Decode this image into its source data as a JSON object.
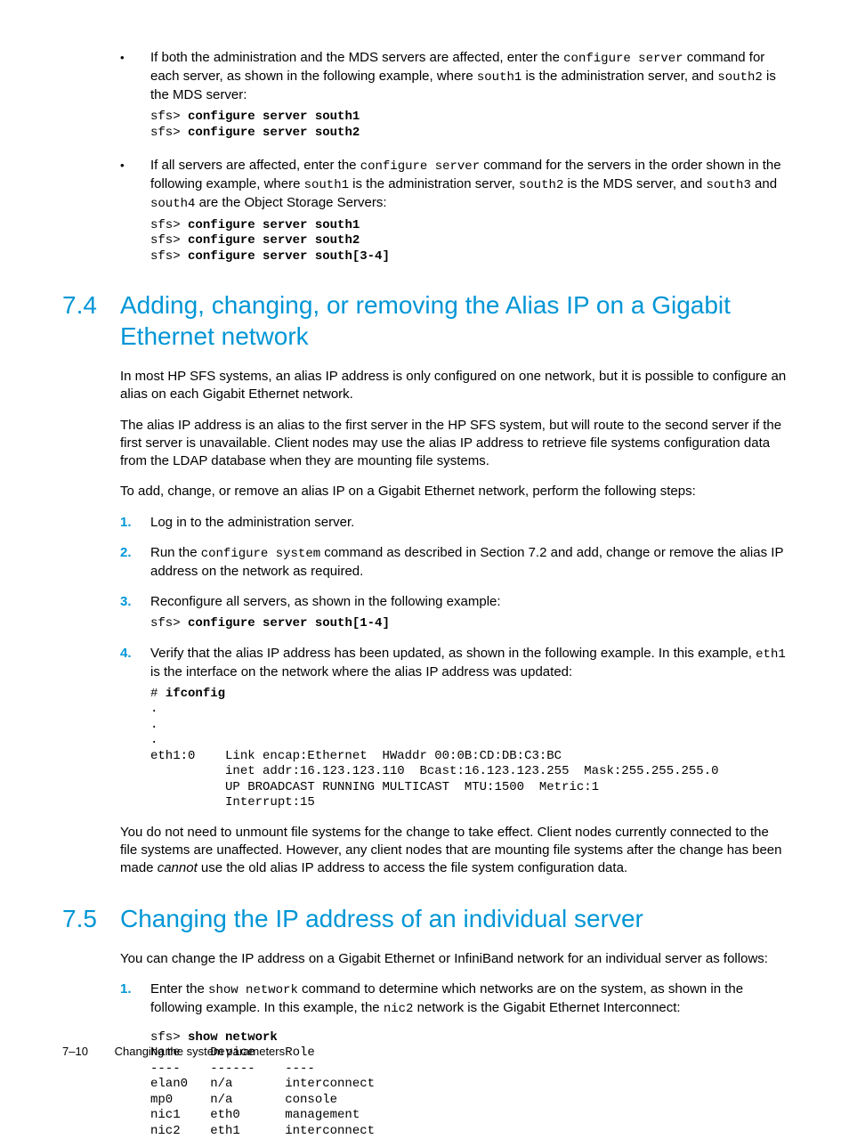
{
  "bullet1": {
    "text_a": "If both the administration and the MDS servers are affected, enter the ",
    "code_a": "configure server",
    "text_b": " command for each server, as shown in the following example, where ",
    "code_b": "south1",
    "text_c": " is the administration server, and ",
    "code_c": "south2",
    "text_d": " is the MDS server:",
    "code_prompt1": "sfs> ",
    "code_cmd1": "configure server south1",
    "code_prompt2": "sfs> ",
    "code_cmd2": "configure server south2"
  },
  "bullet2": {
    "text_a": "If all servers are affected, enter the ",
    "code_a": "configure server",
    "text_b": " command for the servers in the order shown in the following example, where ",
    "code_b": "south1",
    "text_c": " is the administration server, ",
    "code_c": "south2",
    "text_d": " is the MDS server, and ",
    "code_d": "south3",
    "text_e": " and ",
    "code_e": "south4",
    "text_f": " are the Object Storage Servers:",
    "code_prompt1": "sfs> ",
    "code_cmd1": "configure server south1",
    "code_prompt2": "sfs> ",
    "code_cmd2": "configure server south2",
    "code_prompt3": "sfs> ",
    "code_cmd3": "configure server south[3-4]"
  },
  "sec74": {
    "num": "7.4",
    "title": "Adding, changing, or removing the Alias IP on a Gigabit Ethernet network",
    "p1": "In most HP SFS systems, an alias IP address is only configured on one network, but it is possible to configure an alias on each Gigabit Ethernet network.",
    "p2": "The alias IP address is an alias to the first server in the HP SFS system, but will route to the second server if the first server is unavailable. Client nodes may use the alias IP address to retrieve file systems configuration data from the LDAP database when they are mounting file systems.",
    "p3": "To add, change, or remove an alias IP on a Gigabit Ethernet network, perform the following steps:",
    "step1": "Log in to the administration server.",
    "step2a": "Run the ",
    "step2code": "configure system",
    "step2b": " command as described in Section 7.2 and add, change or remove the alias IP address on the network as required.",
    "step3": "Reconfigure all servers, as shown in the following example:",
    "step3_prompt": "sfs> ",
    "step3_cmd": "configure server south[1-4]",
    "step4a": "Verify that the alias IP address has been updated, as shown in the following example. In this example, ",
    "step4code": "eth1",
    "step4b": " is the interface on the network where the alias IP address was updated:",
    "step4_hash": "# ",
    "step4_cmd": "ifconfig",
    "step4_out": ".\n.\n.\neth1:0    Link encap:Ethernet  HWaddr 00:0B:CD:DB:C3:BC\n          inet addr:16.123.123.110  Bcast:16.123.123.255  Mask:255.255.255.0\n          UP BROADCAST RUNNING MULTICAST  MTU:1500  Metric:1\n          Interrupt:15",
    "p4a": "You do not need to unmount file systems for the change to take effect. Client nodes currently connected to the file systems are unaffected. However, any client nodes that are mounting file systems after the change has been made ",
    "p4ital": "cannot",
    "p4b": " use the old alias IP address to access the file system configuration data."
  },
  "sec75": {
    "num": "7.5",
    "title": "Changing the IP address of an individual server",
    "p1": "You can change the IP address on a Gigabit Ethernet or InfiniBand network for an individual server as follows:",
    "step1a": "Enter the ",
    "step1code": "show network",
    "step1b": " command to determine which networks are on the system, as shown in the following example. In this example, the ",
    "step1code2": "nic2",
    "step1c": " network is the Gigabit Ethernet Interconnect:",
    "step1_prompt": "sfs> ",
    "step1_cmd": "show network",
    "step1_out": "Name    Device    Role\n----    ------    ----\nelan0   n/a       interconnect\nmp0     n/a       console\nnic1    eth0      management\nnic2    eth1      interconnect"
  },
  "footer": {
    "page": "7–10",
    "title": "Changing the system parameters"
  }
}
